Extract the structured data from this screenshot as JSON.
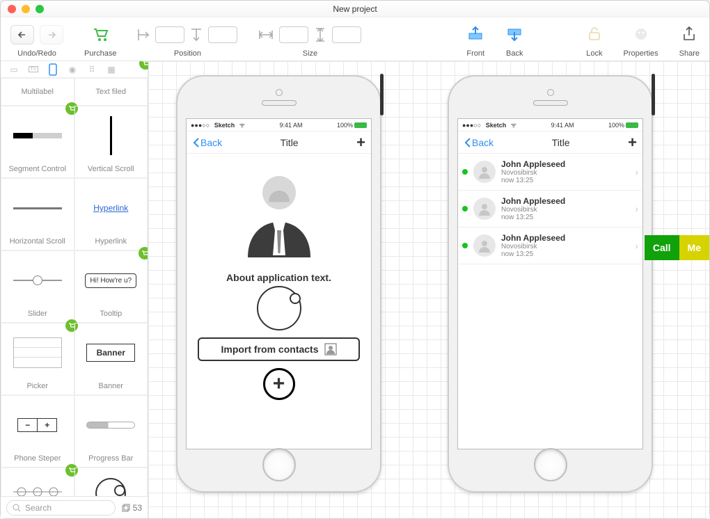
{
  "window": {
    "title": "New project"
  },
  "toolbar": {
    "undo_redo": "Undo/Redo",
    "purchase": "Purchase",
    "position": "Position",
    "size": "Size",
    "front": "Front",
    "back": "Back",
    "lock": "Lock",
    "properties": "Properties",
    "share": "Share"
  },
  "sidebar": {
    "components": [
      {
        "label": "Multilabel"
      },
      {
        "label": "Text filed"
      },
      {
        "label": "Segment Control"
      },
      {
        "label": "Vertical Scroll"
      },
      {
        "label": "Horizontal Scroll"
      },
      {
        "label": "Hyperlink",
        "link_text": "Hyperlink"
      },
      {
        "label": "Slider"
      },
      {
        "label": "Tooltip",
        "tooltip_text": "Hi! How're u?"
      },
      {
        "label": "Picker"
      },
      {
        "label": "Banner",
        "banner_text": "Banner"
      },
      {
        "label": "Phone Steper"
      },
      {
        "label": "Progress Bar"
      }
    ],
    "search_placeholder": "Search",
    "count": "53"
  },
  "phone1": {
    "carrier": "Sketch",
    "time": "9:41 AM",
    "battery": "100%",
    "back": "Back",
    "title": "Title",
    "about": "About application text.",
    "import_label": "Import from contacts"
  },
  "phone2": {
    "carrier": "Sketch",
    "time": "9:41 AM",
    "battery": "100%",
    "back": "Back",
    "title": "Title",
    "rows": [
      {
        "name": "John Appleseed",
        "city": "Novosibirsk",
        "ts": "now 13:25"
      },
      {
        "name": "John Appleseed",
        "city": "Novosibirsk",
        "ts": "now 13:25"
      },
      {
        "name": "John Appleseed",
        "city": "Novosibirsk",
        "ts": "now 13:25"
      }
    ]
  },
  "shop": {
    "call": "Call",
    "me": "Me"
  }
}
